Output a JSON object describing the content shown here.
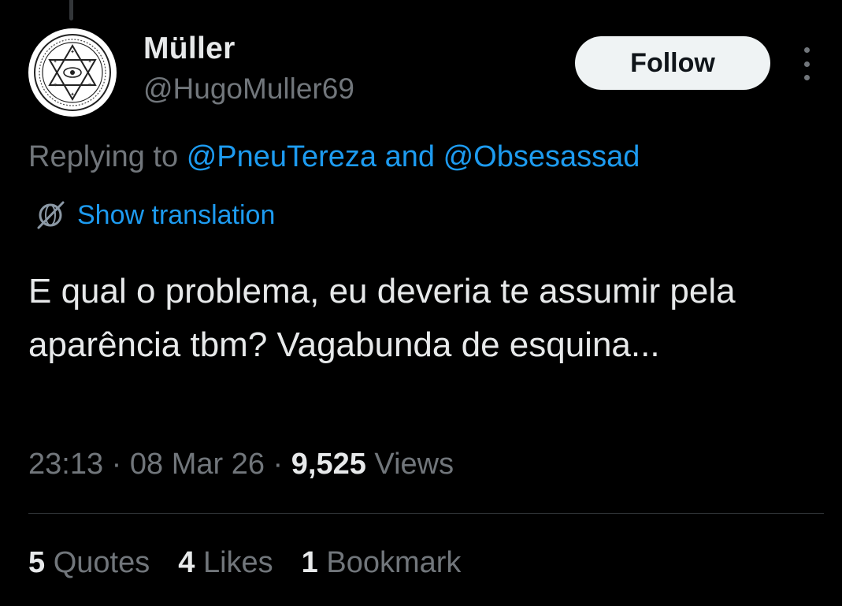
{
  "tweet": {
    "author": {
      "display_name": "Müller",
      "handle": "@HugoMuller69",
      "avatar_icon": "hexagram-seal-icon"
    },
    "follow_label": "Follow",
    "more_icon": "more-vertical-icon",
    "reply": {
      "prefix": "Replying to",
      "user1": "@PneuTereza",
      "conjunction": "and",
      "user2": "@Obsesassad"
    },
    "translation": {
      "icon": "globe-translate-icon",
      "label": "Show translation"
    },
    "text": "E qual o problema, eu deveria te assumir pela aparência tbm? Vagabunda de esquina...",
    "meta": {
      "time": "23:13",
      "separator": "·",
      "date": "08 Mar 26",
      "views_count": "9,525",
      "views_label": "Views"
    },
    "stats": [
      {
        "count": "5",
        "label": "Quotes"
      },
      {
        "count": "4",
        "label": "Likes"
      },
      {
        "count": "1",
        "label": "Bookmark"
      }
    ]
  },
  "colors": {
    "background": "#000000",
    "text_primary": "#e7e9ea",
    "text_secondary": "#71767b",
    "link": "#1d9bf0",
    "follow_button_bg": "#eff3f4",
    "divider": "#2f3336"
  }
}
